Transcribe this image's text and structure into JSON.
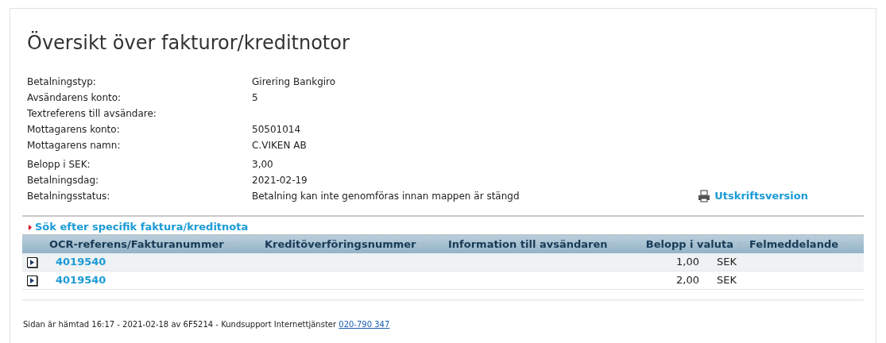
{
  "title": "Översikt över fakturor/kreditnotor",
  "details": [
    {
      "label": "Betalningstyp:",
      "value": "Girering Bankgiro"
    },
    {
      "label": "Avsändarens konto:",
      "value": "5"
    },
    {
      "label": "Textreferens till avsändare:"
    },
    {
      "label": "Mottagarens konto:",
      "value": "50501014"
    },
    {
      "label": "Mottagarens namn:",
      "value": "C.VIKEN AB"
    },
    {
      "label": "Belopp i SEK:",
      "value": "3,00"
    },
    {
      "label": "Betalningsdag:",
      "value": "2021-02-19"
    },
    {
      "label": "Betalningsstatus:",
      "value": "Betalning kan inte genomföras innan mappen är stängd"
    }
  ],
  "print_link": "Utskriftsversion",
  "search_link": "Sök efter specifik faktura/kreditnota",
  "table": {
    "columns": [
      "OCR-referens/Fakturanummer",
      "Kreditöverföringsnummer",
      "Information till avsändaren",
      "Belopp i valuta",
      "Felmeddelande"
    ],
    "rows": [
      {
        "ocr": "4019540",
        "amount": "1,00",
        "currency": "SEK",
        "expanded": false
      },
      {
        "ocr": "4019540",
        "amount": "2,00",
        "currency": "SEK",
        "expanded": false
      }
    ]
  },
  "footer": {
    "text": "Sidan är hämtad 16:17 - 2021-02-18 av 6F5214 - Kundsupport Internettjänster",
    "phone": "020-790 347"
  }
}
